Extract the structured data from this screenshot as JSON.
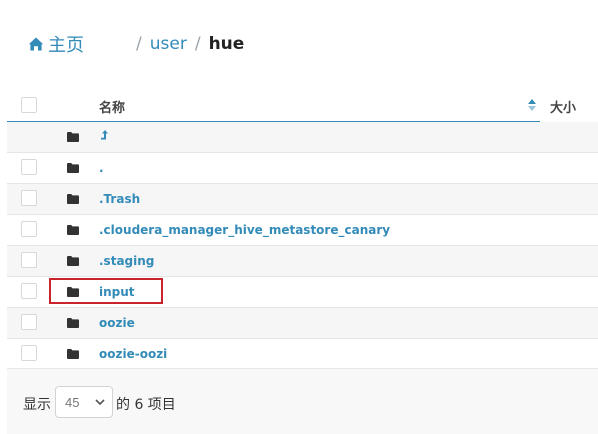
{
  "breadcrumb": {
    "home_label": "主页",
    "separator": "/",
    "path": [
      {
        "label": "user"
      },
      {
        "label": "hue"
      }
    ]
  },
  "table": {
    "columns": {
      "name": "名称",
      "size": "大小"
    },
    "rows": [
      {
        "name": "",
        "type": "parent-folder"
      },
      {
        "name": ".",
        "type": "folder"
      },
      {
        "name": ".Trash",
        "type": "folder"
      },
      {
        "name": ".cloudera_manager_hive_metastore_canary",
        "type": "folder"
      },
      {
        "name": ".staging",
        "type": "folder"
      },
      {
        "name": "input",
        "type": "folder",
        "highlighted": true
      },
      {
        "name": "oozie",
        "type": "folder"
      },
      {
        "name": "oozie-oozi",
        "type": "folder"
      }
    ]
  },
  "footer": {
    "show_label": "显示",
    "page_size": "45",
    "summary": "的 6 项目"
  },
  "colors": {
    "link": "#338bb8",
    "highlight_border": "#c9242b",
    "row_shade": "#f6f6f6"
  }
}
